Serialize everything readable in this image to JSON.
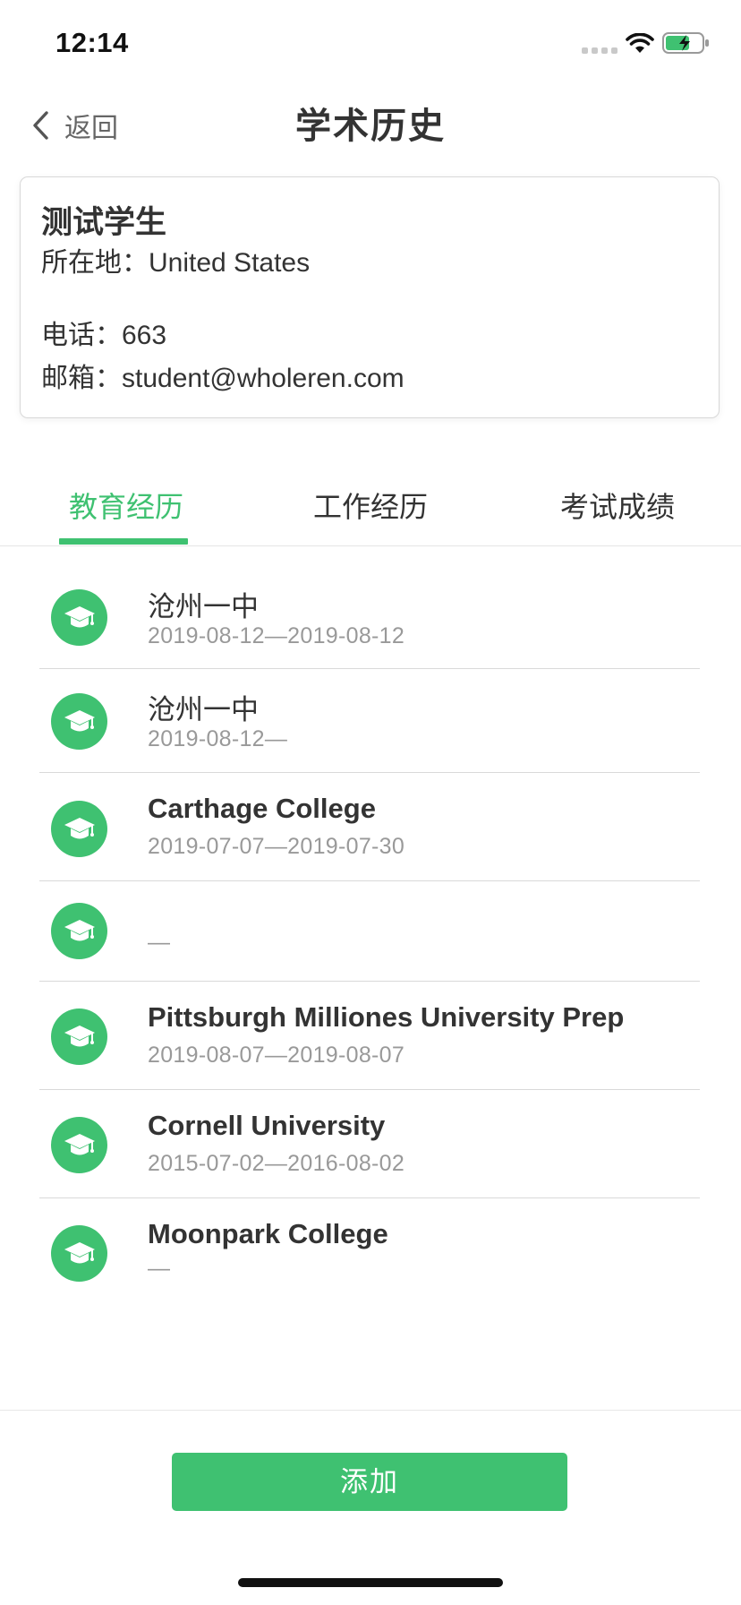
{
  "status_bar": {
    "time": "12:14"
  },
  "nav": {
    "back_label": "返回",
    "title": "学术历史"
  },
  "profile": {
    "name": "测试学生",
    "location": "所在地：United States",
    "phone": "电话：663",
    "email": "邮箱：student@wholeren.com"
  },
  "tabs": {
    "active": "教育经历",
    "items": [
      {
        "label": "教育经历"
      },
      {
        "label": "工作经历"
      },
      {
        "label": "考试成绩"
      }
    ]
  },
  "education": [
    {
      "name": "沧州一中",
      "dates": "2019-08-12—2019-08-12"
    },
    {
      "name": "沧州一中",
      "dates": "2019-08-12—"
    },
    {
      "name": "Carthage College",
      "dates": "2019-07-07—2019-07-30"
    },
    {
      "name": "",
      "dates": "—"
    },
    {
      "name": "Pittsburgh Milliones University Prep",
      "dates": "2019-08-07—2019-08-07"
    },
    {
      "name": "Cornell University",
      "dates": "2015-07-02—2016-08-02"
    },
    {
      "name": "Moonpark College",
      "dates": "—"
    }
  ],
  "actions": {
    "add_label": "添加"
  },
  "colors": {
    "accent": "#3fc171",
    "text": "#333333",
    "muted": "#999999",
    "divider": "#d9d9d9"
  },
  "icons": {
    "education_item": "graduation-cap-icon",
    "back": "chevron-left-icon"
  }
}
